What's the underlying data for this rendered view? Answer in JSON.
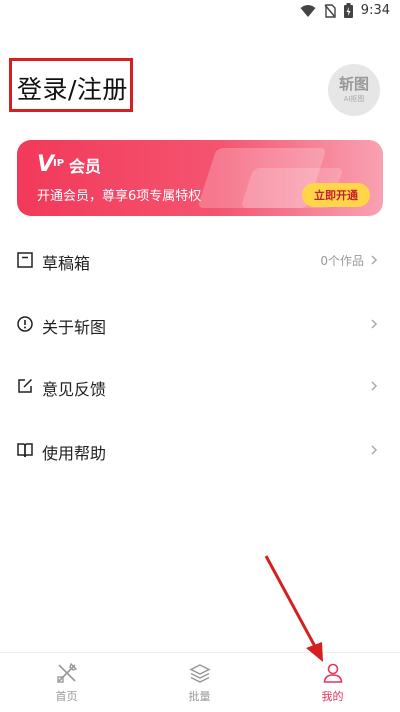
{
  "status_bar": {
    "time": "9:34"
  },
  "header": {
    "login_title": "登录/注册",
    "logo_main": "斩图",
    "logo_sub": "AI抠图"
  },
  "vip_banner": {
    "mark": "V",
    "mark_suffix": "IP",
    "title": "会员",
    "description": "开通会员，尊享6项专属特权",
    "button_label": "立即开通"
  },
  "menu": {
    "items": [
      {
        "label": "草稿箱",
        "meta": "0个作品",
        "icon": "draft-box-icon"
      },
      {
        "label": "关于斩图",
        "meta": "",
        "icon": "info-circle-icon"
      },
      {
        "label": "意见反馈",
        "meta": "",
        "icon": "edit-feedback-icon"
      },
      {
        "label": "使用帮助",
        "meta": "",
        "icon": "book-help-icon"
      }
    ]
  },
  "bottom_nav": {
    "tabs": [
      {
        "label": "首页",
        "icon": "design-tools-icon",
        "active": false
      },
      {
        "label": "批量",
        "icon": "layers-icon",
        "active": false
      },
      {
        "label": "我的",
        "icon": "user-icon",
        "active": true
      }
    ]
  },
  "colors": {
    "accent": "#e8335a",
    "vip_gradient_start": "#f2395a",
    "vip_gradient_end": "#f9a2b2",
    "vip_button": "#ffd54a",
    "annotation_red": "#d42020"
  }
}
